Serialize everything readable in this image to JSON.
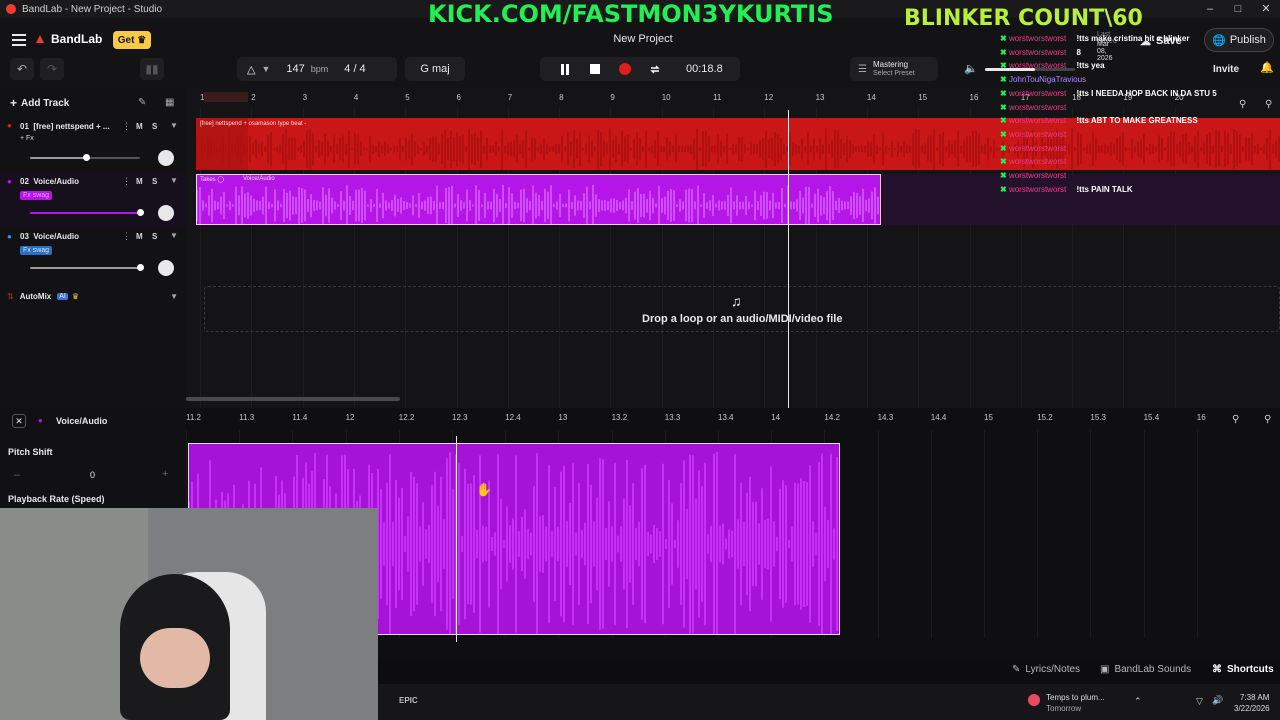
{
  "window": {
    "title": "BandLab - New Project - Studio"
  },
  "header": {
    "brand": "BandLab",
    "get_label": "Get",
    "tempo_value": "147",
    "tempo_unit": "bpm",
    "time_signature": "4 / 4",
    "key": "G maj",
    "project_title": "New Project",
    "time_display": "00:18.8",
    "mastering_label": "Mastering",
    "mastering_sub": "Select Preset",
    "save_label": "Save",
    "publish_label": "Publish",
    "invite_label": "Invite",
    "volume_level": 0.55
  },
  "overlay": {
    "stream_url": "KICK.COM/FASTMON3YKURTIS",
    "counter": "BLINKER COUNT\\60",
    "chat_meta": "Last Saved",
    "chat_date": "Mar 08, 2026",
    "chat": [
      {
        "user": "worstworstworst",
        "msg": "!tts make cristina hit a blinker"
      },
      {
        "user": "worstworstworst",
        "msg": "8"
      },
      {
        "user": "worstworstworst",
        "msg": "!tts yea"
      },
      {
        "user": "JohnTouNigaTravious",
        "msg": ""
      },
      {
        "user": "worstworstworst",
        "msg": "!tts I NEEDA HOP BACK IN DA STU 5"
      },
      {
        "user": "worstworstworst",
        "msg": ""
      },
      {
        "user": "worstworstworst",
        "msg": "!tts ABT TO MAKE GREATNESS"
      },
      {
        "user": "worstworstworst",
        "msg": ""
      },
      {
        "user": "worstworstworst",
        "msg": ""
      },
      {
        "user": "worstworstworst",
        "msg": ""
      },
      {
        "user": "worstworstworst",
        "msg": ""
      },
      {
        "user": "worstworstworst",
        "msg": "!tts PAIN TALK"
      }
    ]
  },
  "tracks_panel": {
    "add_track_label": "Add Track",
    "tracks": [
      {
        "num": "01",
        "name": "[free] nettspend + ...",
        "fx": "+ Fx",
        "mute": "M",
        "solo": "S"
      },
      {
        "num": "02",
        "name": "Voice/Audio",
        "fx": "Fx swag",
        "mute": "M",
        "solo": "S"
      },
      {
        "num": "03",
        "name": "Voice/Audio",
        "fx": "Fx swag",
        "mute": "M",
        "solo": "S"
      }
    ],
    "automix_label": "AutoMix",
    "automix_badge": "AI"
  },
  "arrangement": {
    "ruler": [
      "1",
      "2",
      "3",
      "4",
      "5",
      "6",
      "7",
      "8",
      "9",
      "10",
      "11",
      "12",
      "13",
      "14",
      "15",
      "16",
      "17",
      "18",
      "19",
      "20"
    ],
    "clip1_label": "[free] nettspend + osamason type beat -",
    "clip2_takes": "Takes",
    "clip2_label": "Voice/Audio",
    "drop_text": "Drop a loop or an audio/MIDI/video file"
  },
  "editor": {
    "title": "Voice/Audio",
    "pitch_label": "Pitch Shift",
    "pitch_value": "0",
    "playback_label": "Playback Rate (Speed)",
    "ruler": [
      "11.2",
      "11.3",
      "11.4",
      "12",
      "12.2",
      "12.3",
      "12.4",
      "13",
      "13.2",
      "13.3",
      "13.4",
      "14",
      "14.2",
      "14.3",
      "14.4",
      "15",
      "15.2",
      "15.3",
      "15.4",
      "16"
    ]
  },
  "footer": {
    "lyrics_label": "Lyrics/Notes",
    "sounds_label": "BandLab Sounds",
    "shortcuts_label": "Shortcuts"
  },
  "taskbar": {
    "weather_title": "Temps to plum...",
    "weather_sub": "Tomorrow",
    "time": "7:38 AM",
    "date": "3/22/2026"
  },
  "colors": {
    "accent_red": "#e11d1d",
    "accent_purple": "#b516e8",
    "brand_red": "#f03c2e",
    "get_yellow": "#f7c948",
    "overlay_green": "#22ee55"
  }
}
